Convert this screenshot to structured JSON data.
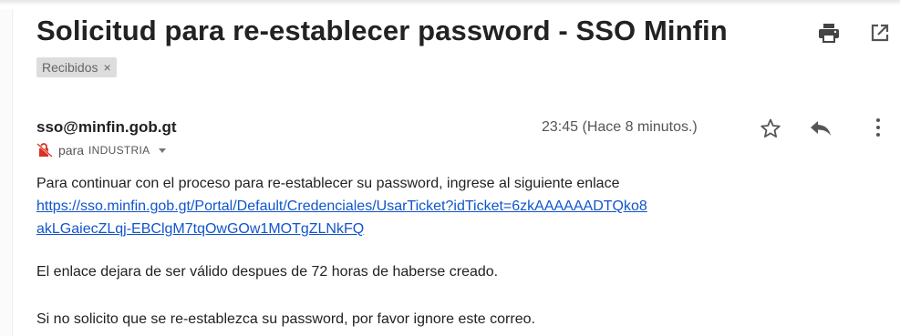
{
  "email": {
    "subject": "Solicitud para re-establecer password - SSO Minfin",
    "label": "Recibidos",
    "label_remove": "×",
    "sender": "sso@minfin.gob.gt",
    "to_prefix": "para",
    "to_name": "INDUSTRIA",
    "timestamp": "23:45 (Hace 8 minutos.)"
  },
  "message": {
    "line1": "Para continuar con el proceso para re-establecer su password, ingrese al siguiente enlace",
    "link_line1": "https://sso.minfin.gob.gt/Portal/Default/Credenciales/UsarTicket?idTicket=6zkAAAAAADTQko8",
    "link_line2": "akLGaiecZLqj-EBClgM7tqOwGOw1MOTgZLNkFQ",
    "line2": "El enlace dejara de ser válido despues de 72 horas de haberse creado.",
    "line3": "Si no solicito que se re-establezca su password, por favor ignore este correo."
  },
  "icons": {
    "print": "print-icon",
    "popout": "open-in-new-window-icon",
    "star": "star-icon",
    "reply": "reply-icon",
    "more": "more-vertical-icon",
    "unencrypted": "no-encryption-icon"
  },
  "colors": {
    "link": "#1155cc",
    "unencrypted": "#d93025",
    "label_bg": "#dddddd"
  }
}
